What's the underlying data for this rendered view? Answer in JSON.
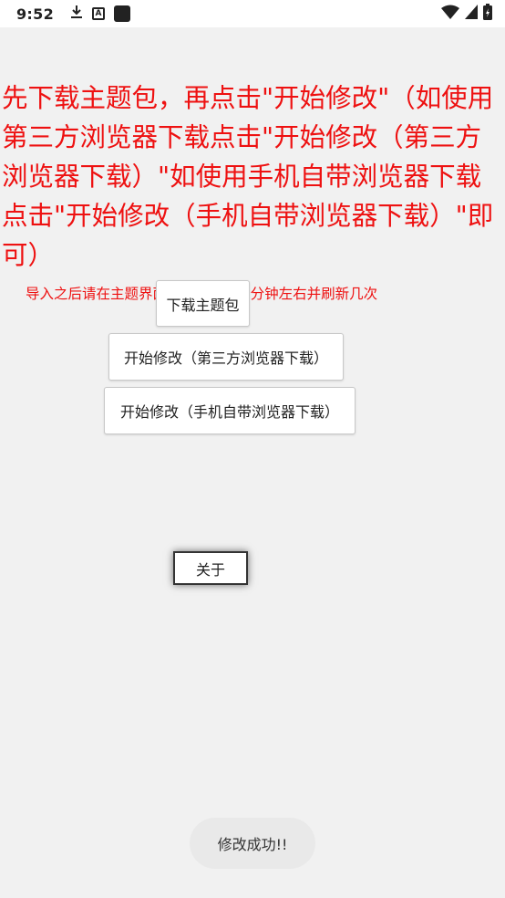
{
  "status_bar": {
    "time": "9:52",
    "left_icons": [
      "download-icon",
      "a-box-icon",
      "square-icon"
    ],
    "right_icons": [
      "wifi-icon",
      "signal-icon",
      "battery-charging-icon"
    ]
  },
  "instructions": {
    "text": "先下载主题包，再点击\"开始修改\"（如使用第三方浏览器下载点击\"开始修改（第三方浏览器下载）\"如使用手机自带浏览器下载点击\"开始修改（手机自带浏览器下载）\"即可）",
    "color": "#ee1111"
  },
  "note": {
    "text": "导入之后请在主题界面等待30秒～1分钟左右并刷新几次"
  },
  "buttons": {
    "download_theme": "下载主题包",
    "modify_third_party": "开始修改（第三方浏览器下载）",
    "modify_builtin": "开始修改（手机自带浏览器下载）",
    "about": "关于"
  },
  "toast": {
    "text": "修改成功!!"
  }
}
